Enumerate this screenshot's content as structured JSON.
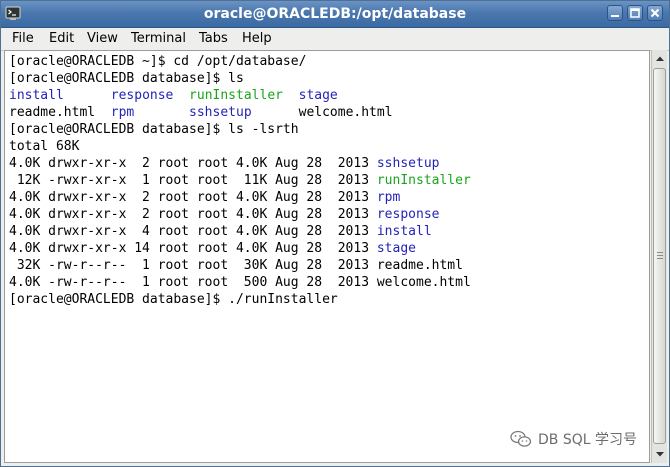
{
  "window": {
    "title": "oracle@ORACLEDB:/opt/database"
  },
  "menubar": {
    "items": [
      {
        "label": "File"
      },
      {
        "label": "Edit"
      },
      {
        "label": "View"
      },
      {
        "label": "Terminal"
      },
      {
        "label": "Tabs"
      },
      {
        "label": "Help"
      }
    ]
  },
  "terminal": {
    "colors": {
      "background": "#ffffff",
      "foreground": "#000000",
      "directory": "#2424b8",
      "executable": "#1aa51a"
    },
    "lines": [
      {
        "segments": [
          {
            "text": "[oracle@ORACLEDB ~]$ cd /opt/database/",
            "color": "default"
          }
        ]
      },
      {
        "segments": [
          {
            "text": "[oracle@ORACLEDB database]$ ls",
            "color": "default"
          }
        ]
      },
      {
        "segments": [
          {
            "text": "install",
            "color": "blue"
          },
          {
            "text": "      ",
            "color": "default"
          },
          {
            "text": "response",
            "color": "blue"
          },
          {
            "text": "  ",
            "color": "default"
          },
          {
            "text": "runInstaller",
            "color": "green"
          },
          {
            "text": "  ",
            "color": "default"
          },
          {
            "text": "stage",
            "color": "blue"
          }
        ]
      },
      {
        "segments": [
          {
            "text": "readme.html  ",
            "color": "default"
          },
          {
            "text": "rpm",
            "color": "blue"
          },
          {
            "text": "       ",
            "color": "default"
          },
          {
            "text": "sshsetup",
            "color": "blue"
          },
          {
            "text": "      welcome.html",
            "color": "default"
          }
        ]
      },
      {
        "segments": [
          {
            "text": "[oracle@ORACLEDB database]$ ls -lsrth",
            "color": "default"
          }
        ]
      },
      {
        "segments": [
          {
            "text": "total 68K",
            "color": "default"
          }
        ]
      },
      {
        "segments": [
          {
            "text": "4.0K drwxr-xr-x  2 root root 4.0K Aug 28  2013 ",
            "color": "default"
          },
          {
            "text": "sshsetup",
            "color": "blue"
          }
        ]
      },
      {
        "segments": [
          {
            "text": " 12K -rwxr-xr-x  1 root root  11K Aug 28  2013 ",
            "color": "default"
          },
          {
            "text": "runInstaller",
            "color": "green"
          }
        ]
      },
      {
        "segments": [
          {
            "text": "4.0K drwxr-xr-x  2 root root 4.0K Aug 28  2013 ",
            "color": "default"
          },
          {
            "text": "rpm",
            "color": "blue"
          }
        ]
      },
      {
        "segments": [
          {
            "text": "4.0K drwxr-xr-x  2 root root 4.0K Aug 28  2013 ",
            "color": "default"
          },
          {
            "text": "response",
            "color": "blue"
          }
        ]
      },
      {
        "segments": [
          {
            "text": "4.0K drwxr-xr-x  4 root root 4.0K Aug 28  2013 ",
            "color": "default"
          },
          {
            "text": "install",
            "color": "blue"
          }
        ]
      },
      {
        "segments": [
          {
            "text": "4.0K drwxr-xr-x 14 root root 4.0K Aug 28  2013 ",
            "color": "default"
          },
          {
            "text": "stage",
            "color": "blue"
          }
        ]
      },
      {
        "segments": [
          {
            "text": " 32K -rw-r--r--  1 root root  30K Aug 28  2013 readme.html",
            "color": "default"
          }
        ]
      },
      {
        "segments": [
          {
            "text": "4.0K -rw-r--r--  1 root root  500 Aug 28  2013 welcome.html",
            "color": "default"
          }
        ]
      },
      {
        "segments": [
          {
            "text": "[oracle@ORACLEDB database]$ ./runInstaller",
            "color": "default"
          }
        ]
      }
    ]
  },
  "watermark": {
    "text": "DB SQL 学习号",
    "icon": "wechat-icon"
  },
  "icons": {
    "app": "terminal-app-icon",
    "minimize": "minimize-icon",
    "maximize": "maximize-icon",
    "close": "close-icon",
    "scroll_up": "scroll-up-arrow-icon",
    "scroll_down": "scroll-down-arrow-icon"
  }
}
